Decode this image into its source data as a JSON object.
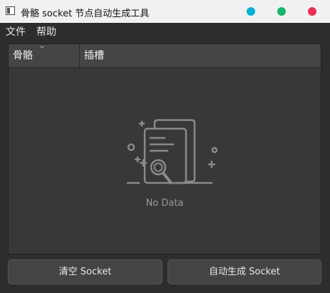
{
  "window": {
    "title": "骨骼 socket 节点自动生成工具",
    "controls": [
      {
        "name": "minimize",
        "color": "#00b2d6"
      },
      {
        "name": "maximize",
        "color": "#1ab76a"
      },
      {
        "name": "close",
        "color": "#ea2f58"
      }
    ]
  },
  "menu": {
    "file": "文件",
    "help": "帮助"
  },
  "table": {
    "columns": [
      "骨骼",
      "插槽"
    ],
    "empty_text": "No Data"
  },
  "buttons": {
    "clear": "清空 Socket",
    "auto_generate": "自动生成 Socket"
  }
}
